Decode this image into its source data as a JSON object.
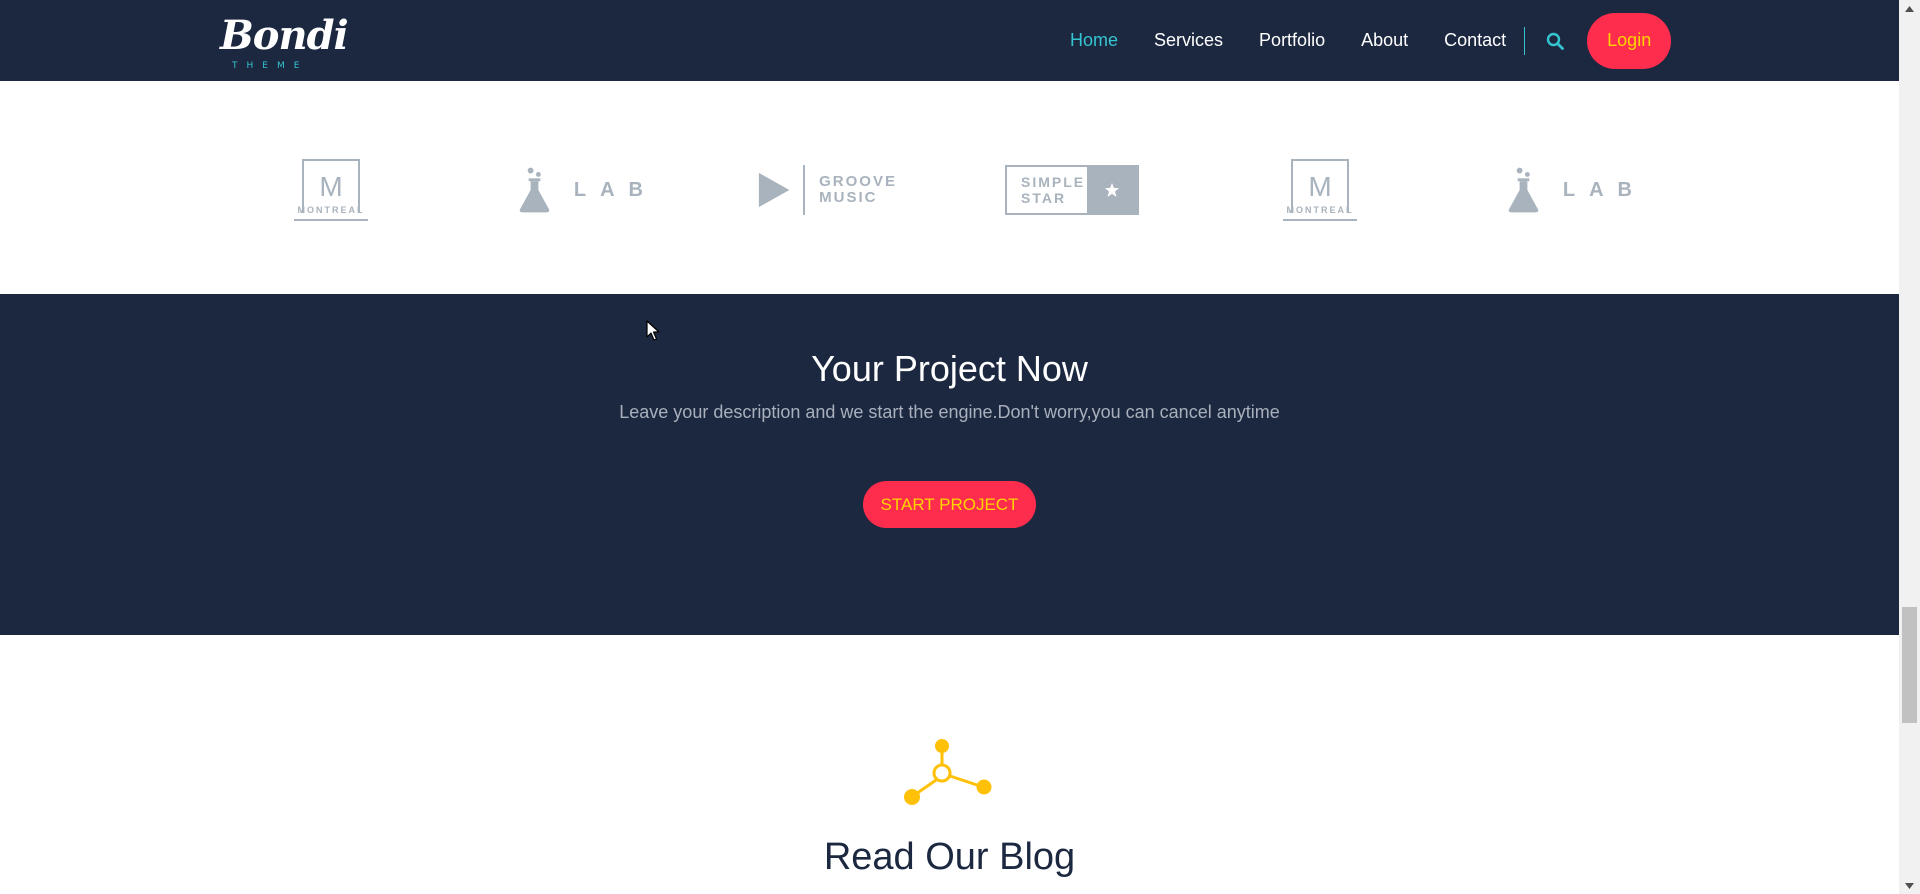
{
  "nav": {
    "logo_word": "Bondi",
    "logo_sub": "THEME",
    "links": [
      "Home",
      "Services",
      "Portfolio",
      "About",
      "Contact"
    ],
    "active_link": "Home",
    "login": "Login",
    "search_icon": "search-icon"
  },
  "clients": {
    "montreal": {
      "letter": "M",
      "name": "MONTREAL"
    },
    "lab": {
      "name": "LAB"
    },
    "groove": {
      "line1": "GROOVE",
      "line2": "MUSIC"
    },
    "simplestar": {
      "line1": "SIMPLE",
      "line2": "STAR"
    }
  },
  "cta": {
    "title": "Your Project Now",
    "subtitle": "Leave your description and we start the engine.Don't worry,you can cancel anytime",
    "button": "START PROJECT"
  },
  "blog": {
    "icon": "molecule-icon",
    "title": "Read Our Blog"
  },
  "colors": {
    "navy": "#1c2840",
    "accent": "#ff2d4d",
    "button_text": "#ffd400",
    "teal": "#35c5d0",
    "logo_gray": "#a9b3bd",
    "blog_icon": "#ffc107"
  }
}
